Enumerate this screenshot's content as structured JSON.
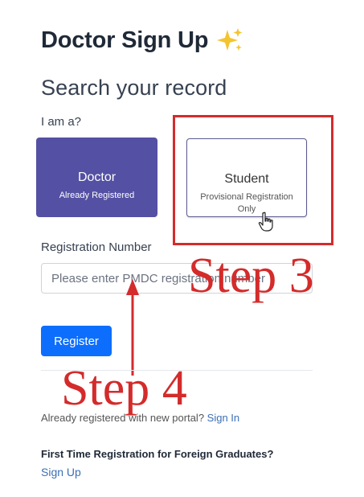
{
  "header": {
    "title": "Doctor Sign Up",
    "sparkle_icon": "sparkles-icon"
  },
  "search": {
    "heading": "Search your record",
    "role_label": "I am a?"
  },
  "roles": {
    "doctor": {
      "title": "Doctor",
      "subtitle": "Already Registered",
      "background": "#5450a3"
    },
    "student": {
      "title": "Student",
      "subtitle": "Provisional Registration Only"
    }
  },
  "registration": {
    "label": "Registration Number",
    "value": "",
    "placeholder": "Please enter PMDC registration number"
  },
  "actions": {
    "register_label": "Register",
    "register_color": "#0d6efd"
  },
  "annotations": {
    "step3": "Step 3",
    "step4": "Step 4",
    "color": "#d42b2b"
  },
  "footer": {
    "signin_text": "Already registered with new portal?",
    "signin_link": "Sign In",
    "foreign_heading": "First Time Registration for Foreign Graduates?",
    "signup_link": "Sign Up"
  }
}
